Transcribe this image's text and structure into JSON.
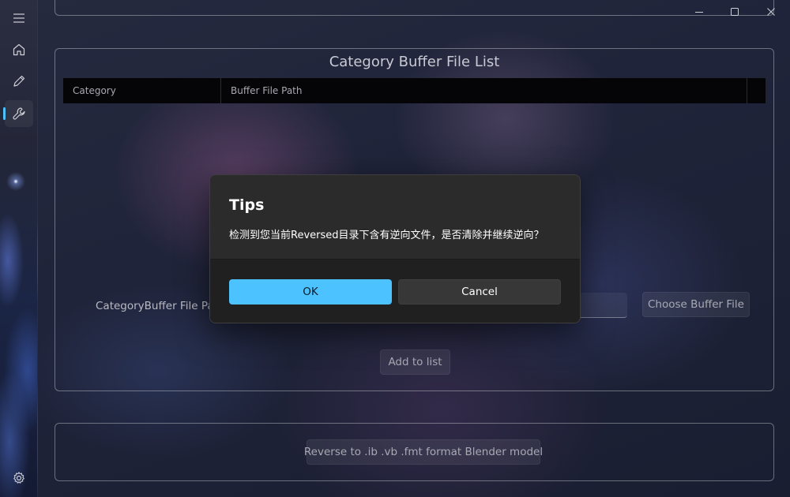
{
  "window": {
    "minimize_label": "—",
    "maximize_label": "☐",
    "close_label": "✕"
  },
  "nav": {
    "menu_icon": "hamburger-icon",
    "items": [
      {
        "name": "home",
        "icon": "home-icon"
      },
      {
        "name": "edit",
        "icon": "pencil-icon"
      },
      {
        "name": "tools",
        "icon": "wrench-icon",
        "active": true
      }
    ],
    "settings_icon": "gear-icon",
    "accent": "#4cc2ff"
  },
  "main": {
    "panel_title": "Category Buffer File List",
    "table": {
      "columns": [
        "Category",
        "Buffer File Path",
        ""
      ]
    },
    "field_label": "CategoryBuffer File Path",
    "choose_button": "Choose Buffer File",
    "add_button": "Add to list",
    "reverse_button": "Reverse to .ib .vb .fmt format Blender model"
  },
  "dialog": {
    "title": "Tips",
    "message": "检测到您当前Reversed目录下含有逆向文件，是否清除并继续逆向？",
    "ok_label": "OK",
    "cancel_label": "Cancel",
    "ok_color": "#4cc2ff"
  }
}
